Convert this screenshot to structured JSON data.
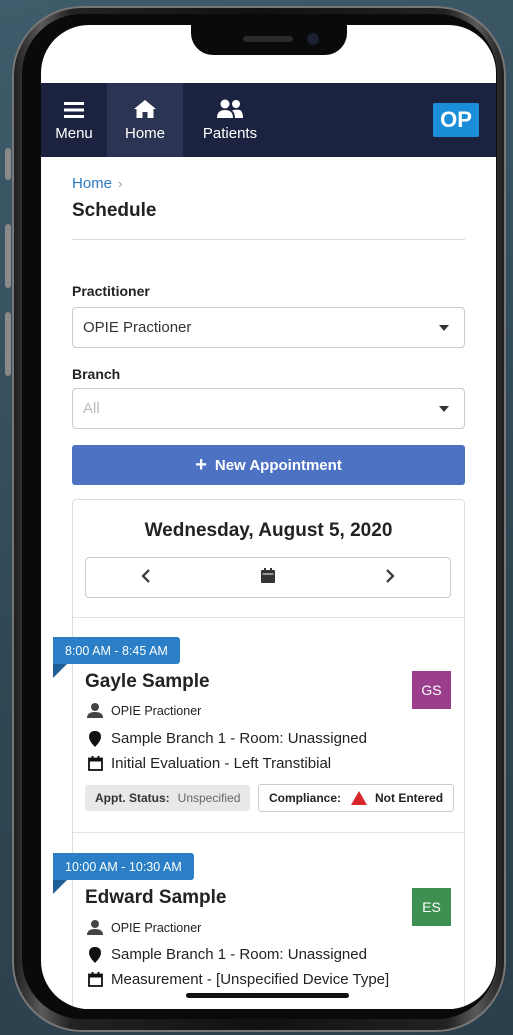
{
  "navbar": {
    "items": [
      {
        "label": "Menu",
        "icon": "hamburger-icon"
      },
      {
        "label": "Home",
        "icon": "home-icon",
        "active": true
      },
      {
        "label": "Patients",
        "icon": "users-icon"
      }
    ],
    "logo_text": "OP"
  },
  "breadcrumb": {
    "home": "Home"
  },
  "page_title": "Schedule",
  "filters": {
    "practitioner_label": "Practitioner",
    "practitioner_value": "OPIE Practioner",
    "branch_label": "Branch",
    "branch_placeholder": "All"
  },
  "new_appointment_label": "New Appointment",
  "schedule": {
    "date": "Wednesday, August 5, 2020",
    "appointments": [
      {
        "time": "8:00 AM - 8:45 AM",
        "patient": "Gayle Sample",
        "initials": "GS",
        "avatar_color": "#9b3f8c",
        "practitioner": "OPIE Practioner",
        "location": "Sample Branch 1 - Room: Unassigned",
        "appt_type": "Initial Evaluation - Left Transtibial",
        "status_label": "Appt. Status:",
        "status_value": "Unspecified",
        "compliance_label": "Compliance:",
        "compliance_value": "Not Entered"
      },
      {
        "time": "10:00 AM - 10:30 AM",
        "patient": "Edward Sample",
        "initials": "ES",
        "avatar_color": "#3d8f52",
        "practitioner": "OPIE Practioner",
        "location": "Sample Branch 1 - Room: Unassigned",
        "appt_type": "Measurement - [Unspecified Device Type]"
      }
    ]
  },
  "colors": {
    "navbar": "#1c2340",
    "accent_blue": "#2a7fc6",
    "button_blue": "#4d72c4",
    "logo_blue": "#1a8ed8",
    "warning_red": "#d9262a"
  }
}
